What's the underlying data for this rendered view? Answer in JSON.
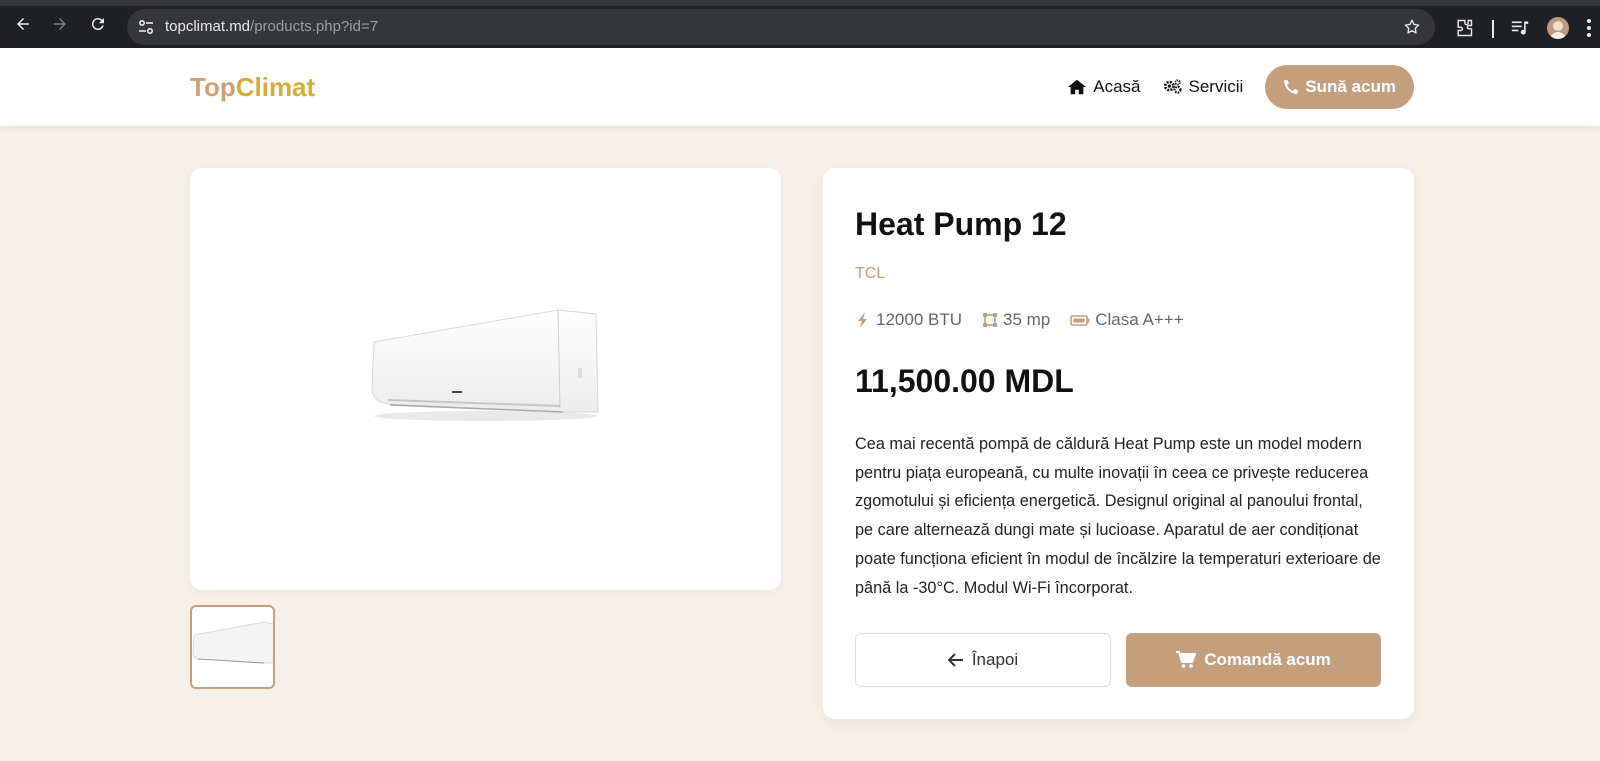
{
  "browser": {
    "url_domain": "topclimat.md",
    "url_path": "/products.php?id=7"
  },
  "header": {
    "logo_part1": "Top",
    "logo_part2": "Climat",
    "nav": [
      {
        "label": "Acasă",
        "icon": "home-icon"
      },
      {
        "label": "Servicii",
        "icon": "gears-icon"
      }
    ],
    "call_label": "Sună acum"
  },
  "product": {
    "title": "Heat Pump 12",
    "brand": "TCL",
    "specs": [
      {
        "icon": "bolt-icon",
        "label": "12000 BTU"
      },
      {
        "icon": "area-icon",
        "label": "35 mp"
      },
      {
        "icon": "battery-icon",
        "label": "Clasa A+++"
      }
    ],
    "price": "11,500.00 MDL",
    "description": "Cea mai recentă pompă de căldură Heat Pump este un model modern pentru piața europeană, cu multe inovații în ceea ce privește reducerea zgomotului și eficiența energetică. Designul original al panoului frontal, pe care alternează dungi mate și lucioase. Aparatul de aer condiționat poate funcționa eficient în modul de încălzire la temperaturi exterioare de până la -30°C. Modul Wi-Fi încorporat.",
    "back_label": "Înapoi",
    "order_label": "Comandă acum"
  },
  "colors": {
    "accent": "#c49f7e",
    "background": "#f6f1e8",
    "logo_gold": "#d4ad3a"
  }
}
